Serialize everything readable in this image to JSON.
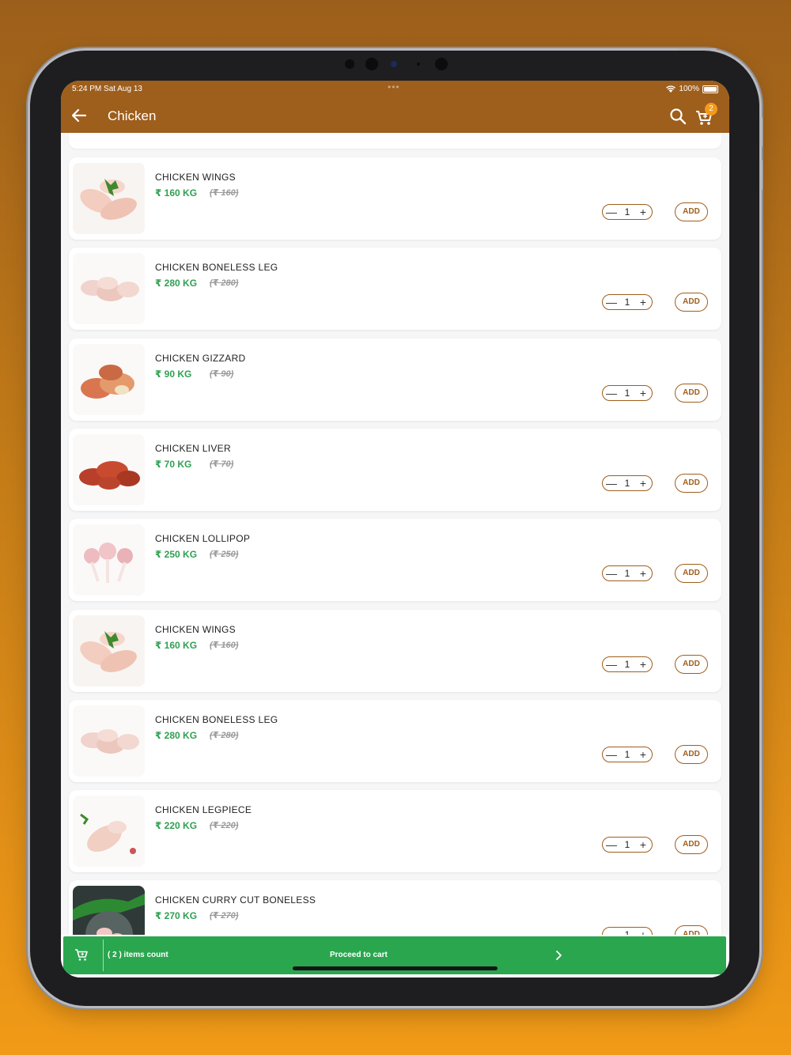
{
  "status_bar": {
    "time": "5:24 PM  Sat Aug 13",
    "battery": "100%"
  },
  "header": {
    "title": "Chicken",
    "cart_count": "2"
  },
  "products": [
    {
      "name": "CHICKEN WINGS",
      "price": "₹ 160 KG",
      "old_price": "(₹ 160)",
      "qty": "1",
      "add_label": "ADD"
    },
    {
      "name": "CHICKEN BONELESS LEG",
      "price": "₹ 280 KG",
      "old_price": "(₹ 280)",
      "qty": "1",
      "add_label": "ADD"
    },
    {
      "name": "CHICKEN GIZZARD",
      "price": "₹ 90 KG",
      "old_price": "(₹ 90)",
      "qty": "1",
      "add_label": "ADD"
    },
    {
      "name": "CHICKEN LIVER",
      "price": "₹ 70 KG",
      "old_price": "(₹ 70)",
      "qty": "1",
      "add_label": "ADD"
    },
    {
      "name": "CHICKEN LOLLIPOP",
      "price": "₹ 250 KG",
      "old_price": "(₹ 250)",
      "qty": "1",
      "add_label": "ADD"
    },
    {
      "name": "CHICKEN WINGS",
      "price": "₹ 160 KG",
      "old_price": "(₹ 160)",
      "qty": "1",
      "add_label": "ADD"
    },
    {
      "name": "CHICKEN BONELESS LEG",
      "price": "₹ 280 KG",
      "old_price": "(₹ 280)",
      "qty": "1",
      "add_label": "ADD"
    },
    {
      "name": "CHICKEN LEGPIECE",
      "price": "₹ 220 KG",
      "old_price": "(₹ 220)",
      "qty": "1",
      "add_label": "ADD"
    },
    {
      "name": "CHICKEN CURRY CUT BONELESS",
      "price": "₹ 270 KG",
      "old_price": "(₹ 270)",
      "qty": "1",
      "add_label": "ADD"
    }
  ],
  "cart_bar": {
    "items_count": "( 2 ) items count",
    "proceed_label": "Proceed to cart"
  },
  "colors": {
    "primary_brown": "#9e5e1c",
    "price_green": "#2fa052",
    "cart_bar_green": "#2aa64f",
    "badge_orange": "#f39a1a"
  },
  "icons": [
    "back-arrow-icon",
    "search-icon",
    "cart-icon",
    "minus-icon",
    "plus-icon",
    "chevron-right-icon"
  ]
}
